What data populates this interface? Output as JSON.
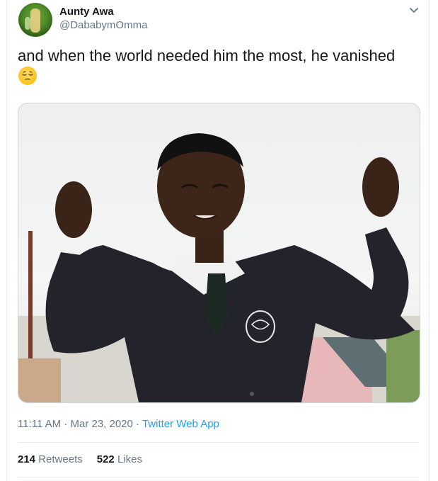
{
  "tweet": {
    "author_name": "Aunty Awa",
    "author_handle": "@DababymOmma",
    "text": "and when the world needed him the most, he vanished",
    "emoji": "pensive-face-emoji",
    "timestamp": "11:11 AM · Mar 23, 2020",
    "separator": " · ",
    "source": "Twitter Web App",
    "retweets_count": "214",
    "retweets_label": "Retweets",
    "likes_count": "522",
    "likes_label": "Likes"
  },
  "icons": {
    "menu": "chevron-down-icon"
  },
  "colors": {
    "link": "#1da1f2",
    "secondary_text": "#657786",
    "primary_text": "#14171a",
    "border": "#e6ecf0"
  }
}
